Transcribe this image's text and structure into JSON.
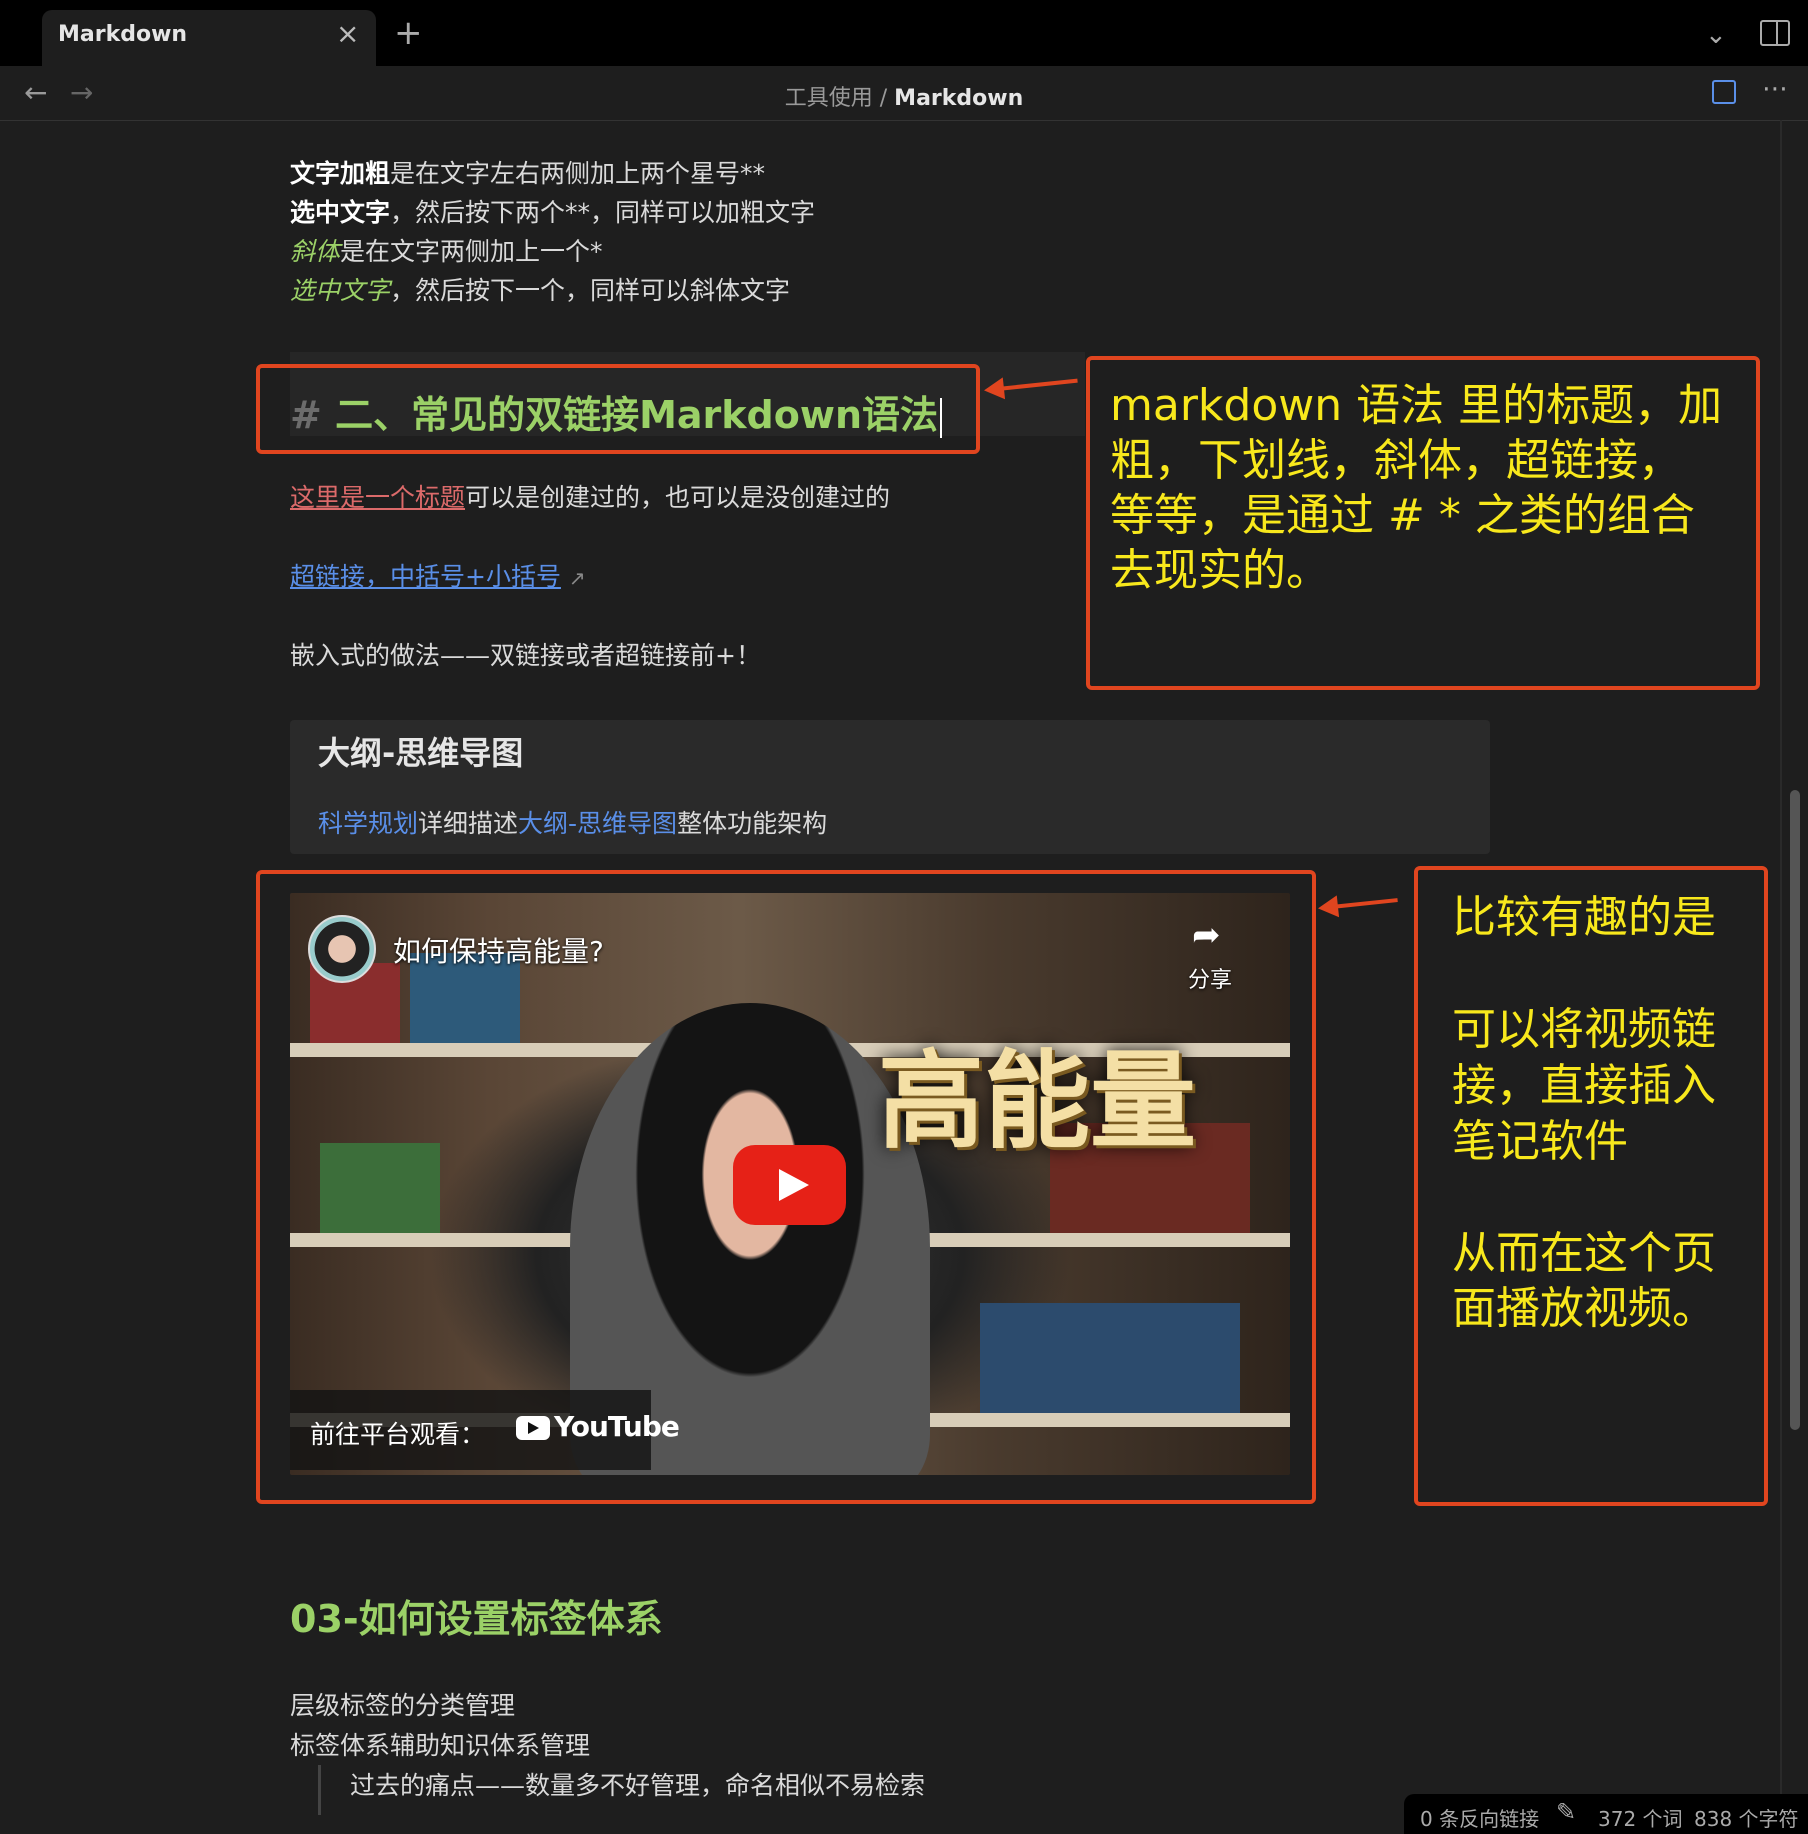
{
  "tab": {
    "title": "Markdown",
    "close": "×",
    "add": "+"
  },
  "nav": {
    "back": "←",
    "forward": "→",
    "breadcrumb_parent": "工具使用",
    "breadcrumb_sep": "/",
    "breadcrumb_current": "Markdown",
    "more": "⋯"
  },
  "content": {
    "line1_bold": "文字加粗",
    "line1_rest": "是在文字左右两侧加上两个星号**",
    "line2_bold": "选中文字",
    "line2_rest": "，然后按下两个**，同样可以加粗文字",
    "line3_ital": "斜体",
    "line3_rest": "是在文字两侧加上一个*",
    "line4_ital": "选中文字",
    "line4_rest": "，然后按下一个，同样可以斜体文字",
    "heading_hash": "#",
    "heading_text": "二、常见的双链接Markdown语法",
    "wikilink_text": "这里是一个标题",
    "wikilink_rest": "可以是创建过的，也可以是没创建过的",
    "hyperlink_text": "超链接，中括号+小括号",
    "embed_line": "嵌入式的做法——双链接或者超链接前+！",
    "card_title": "大纲-思维导图",
    "card_link1": "科学规划",
    "card_mid": "详细描述",
    "card_link2": "大纲-思维导图",
    "card_end": "整体功能架构",
    "h3": "03-如何设置标签体系",
    "tag_line1": "层级标签的分类管理",
    "tag_line2": "标签体系辅助知识体系管理",
    "quote_line": "过去的痛点——数量多不好管理，命名相似不易检索"
  },
  "video": {
    "title": "如何保持高能量?",
    "share": "分享",
    "overlay_text": "高能量",
    "watch_on": "前往平台观看：",
    "platform": "YouTube"
  },
  "status": {
    "backlinks": "0 条反向链接",
    "words": "372 个词",
    "chars": "838 个字符"
  },
  "annotations": {
    "top": [
      "markdown 语法 里的标题，加",
      "粗，下划线，斜体，超链接，",
      "等等，是通过 # * 之类的组合",
      "去现实的。"
    ],
    "right": [
      "比较有趣的是",
      "",
      "可以将视频链",
      "接，直接插入",
      "笔记软件",
      "",
      "从而在这个页",
      "面播放视频。"
    ]
  },
  "colors": {
    "accent_green": "#9bd167",
    "link_blue": "#5a8fe8",
    "link_red": "#dc6a6a",
    "annotation_red": "#e0451f",
    "annotation_yellow": "#f8e81c"
  }
}
